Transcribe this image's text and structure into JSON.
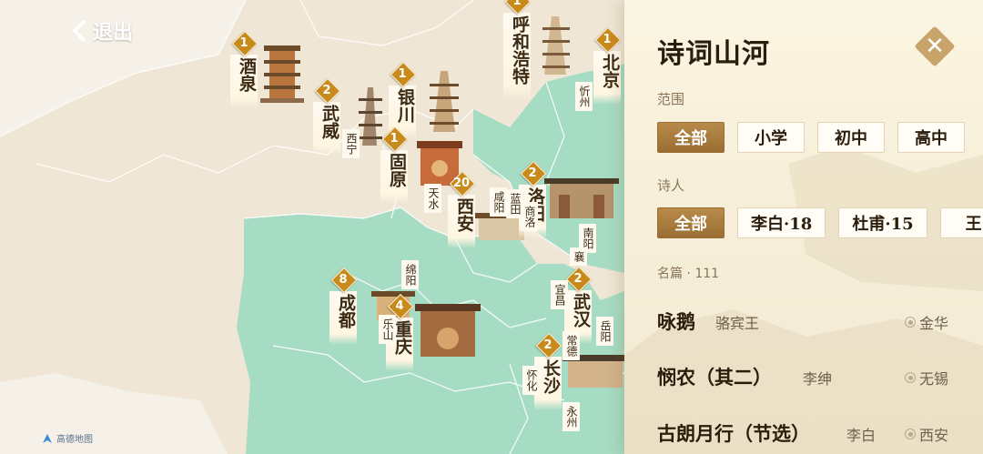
{
  "back_label": "退出",
  "map_logo": "高德地图",
  "cities": [
    {
      "name": "酒泉",
      "count": "1"
    },
    {
      "name": "武威",
      "count": "2"
    },
    {
      "name": "银川",
      "count": "1"
    },
    {
      "name": "固原",
      "count": "1"
    },
    {
      "name": "呼和浩特",
      "count": "1"
    },
    {
      "name": "北京",
      "count": "1"
    },
    {
      "name": "西安",
      "count": "20"
    },
    {
      "name": "洛阳",
      "count": "2"
    },
    {
      "name": "成都",
      "count": "8"
    },
    {
      "name": "重庆",
      "count": "4"
    },
    {
      "name": "武汉",
      "count": "2"
    },
    {
      "name": "长沙",
      "count": "2"
    }
  ],
  "small_labels": [
    "西宁",
    "天水",
    "咸阳",
    "蓝田",
    "商洛",
    "忻州",
    "绵阳",
    "乐山",
    "宜昌",
    "常德",
    "岳阳",
    "怀化",
    "永州",
    "南阳",
    "襄"
  ],
  "panel": {
    "title": "诗词山河",
    "scope_label": "范围",
    "scope_chips": [
      "全部",
      "小学",
      "初中",
      "高中"
    ],
    "poet_label": "诗人",
    "poet_chips": [
      "全部",
      "李白·18",
      "杜甫·15",
      "王"
    ],
    "count_label": "名篇 · 111",
    "poems": [
      {
        "title": "咏鹅",
        "author": "骆宾王",
        "place": "金华"
      },
      {
        "title": "悯农（其二）",
        "author": "李绅",
        "place": "无锡"
      },
      {
        "title": "古朗月行（节选）",
        "author": "李白",
        "place": "西安"
      }
    ]
  },
  "colors": {
    "green": "#a7dcc4",
    "land": "#efe6d6",
    "accent": "#c98a1c",
    "chip_active": "#a57a3d"
  }
}
